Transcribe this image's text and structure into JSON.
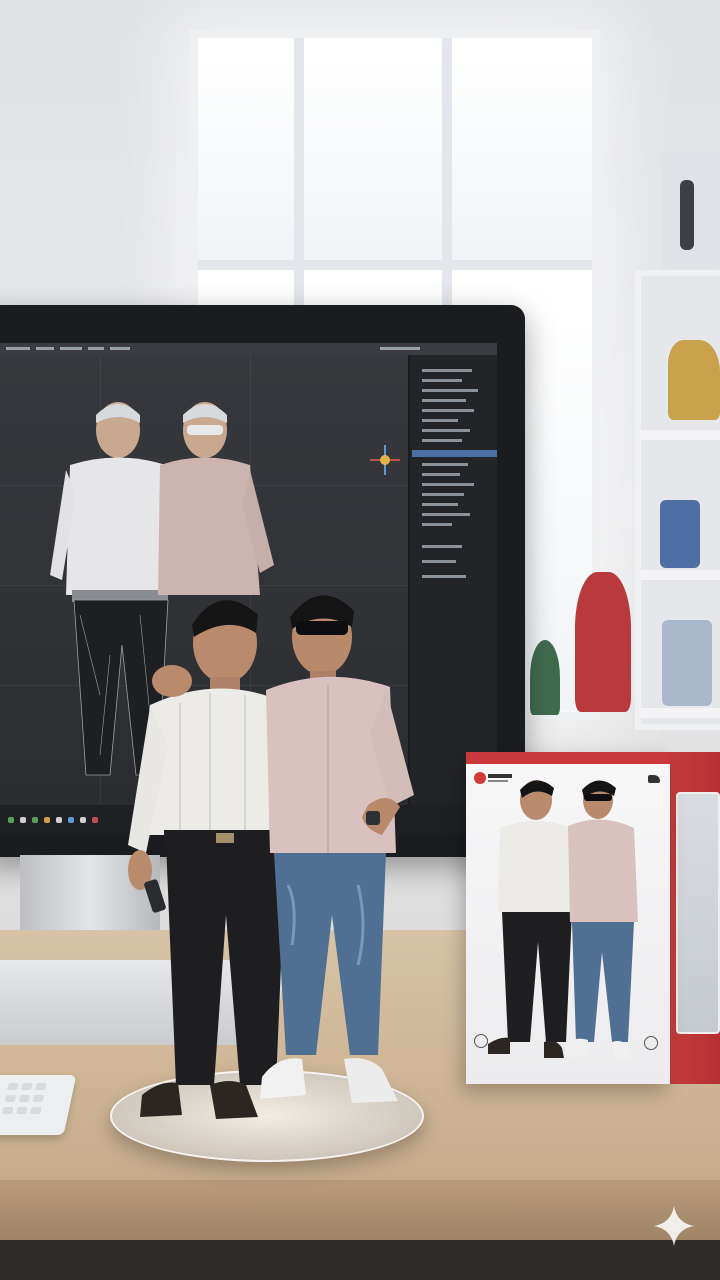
{
  "scene": {
    "colors": {
      "wall": "#e3e4e6",
      "desk": "#cdb494",
      "monitor_bezel": "#1b1c1f",
      "box_accent": "#c9393b",
      "shirt_white": "#ecebe8",
      "shirt_pink": "#d9c1bf",
      "trousers_black": "#1e1e20",
      "jeans_blue": "#4f6f93"
    },
    "icons": [
      "sparkle-icon",
      "axis-gizmo-icon",
      "box-logo-icon"
    ]
  }
}
